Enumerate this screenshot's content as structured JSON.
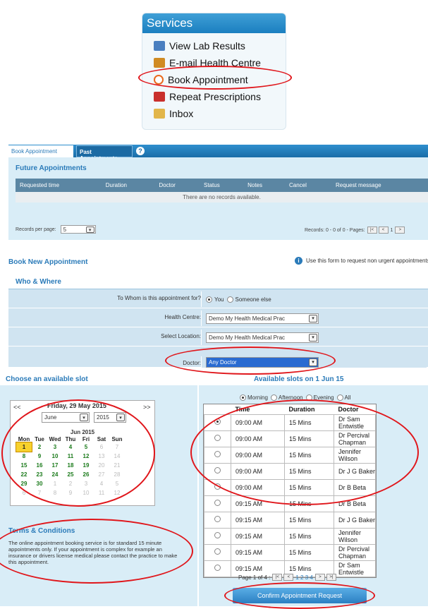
{
  "services": {
    "title": "Services",
    "items": [
      {
        "label": "View Lab Results",
        "icon": "lab-results-icon",
        "color": "#4a7fc0"
      },
      {
        "label": "E-mail Health Centre",
        "icon": "email-centre-icon",
        "color": "#d08b22"
      },
      {
        "label": "Book Appointment",
        "icon": "clock-icon",
        "color": "#e86a1e"
      },
      {
        "label": "Repeat Prescriptions",
        "icon": "pills-icon",
        "color": "#c9302c"
      },
      {
        "label": "Inbox",
        "icon": "envelope-icon",
        "color": "#e2b64a"
      }
    ]
  },
  "tabs": {
    "book": "Book Appointment",
    "past": "Past Appointments",
    "help": "?"
  },
  "future": {
    "title": "Future Appointments",
    "columns": [
      "Requested time",
      "Duration",
      "Doctor",
      "Status",
      "Notes",
      "Cancel",
      "Request message"
    ],
    "empty": "There are no records available.",
    "records_label": "Records per page:",
    "records_value": "5",
    "records_info": "Records: 0 - 0 of 0 - Pages:",
    "page": "1"
  },
  "book_new": {
    "title": "Book New Appointment",
    "info": "Use this form to request non urgent appointments"
  },
  "who_where": {
    "title": "Who & Where",
    "whom_label": "To Whom is this appointment for?",
    "whom_you": "You",
    "whom_else": "Someone else",
    "centre_label": "Health Centre:",
    "centre_value": "Demo My Health Medical Prac",
    "location_label": "Select Location:",
    "location_value": "Demo My Health Medical Prac",
    "doctor_label": "Doctor:",
    "doctor_value": "Any Doctor"
  },
  "slot": {
    "choose_title": "Choose an available slot",
    "available_title": "Available slots on 1 Jun 15",
    "filters": [
      "Morning",
      "Afternoon",
      "Evening",
      "All"
    ],
    "columns": [
      "Time",
      "Duration",
      "Doctor"
    ],
    "rows": [
      {
        "time": "09:00 AM",
        "duration": "15 Mins",
        "doctor": "Dr Sam Entwistle",
        "selected": true
      },
      {
        "time": "09:00 AM",
        "duration": "15 Mins",
        "doctor": "Dr Percival Chapman",
        "selected": false
      },
      {
        "time": "09:00 AM",
        "duration": "15 Mins",
        "doctor": "Jennifer Wilson",
        "selected": false
      },
      {
        "time": "09:00 AM",
        "duration": "15 Mins",
        "doctor": "Dr J G Baker",
        "selected": false
      },
      {
        "time": "09:00 AM",
        "duration": "15 Mins",
        "doctor": "Dr B Beta",
        "selected": false
      },
      {
        "time": "09:15 AM",
        "duration": "15 Mins",
        "doctor": "Dr B Beta",
        "selected": false
      },
      {
        "time": "09:15 AM",
        "duration": "15 Mins",
        "doctor": "Dr J G Baker",
        "selected": false
      },
      {
        "time": "09:15 AM",
        "duration": "15 Mins",
        "doctor": "Jennifer Wilson",
        "selected": false
      },
      {
        "time": "09:15 AM",
        "duration": "15 Mins",
        "doctor": "Dr Percival Chapman",
        "selected": false
      },
      {
        "time": "09:15 AM",
        "duration": "15 Mins",
        "doctor": "Dr Sam Entwistle",
        "selected": false
      }
    ],
    "page_info": "Page 1 of 4 :",
    "pages": "1 2 3 4",
    "confirm": "Confirm Appointment Request"
  },
  "calendar": {
    "current": "Friday, 29 May 2015",
    "prev": "<<",
    "next": ">>",
    "month": "June",
    "year": "2015",
    "month_title": "Jun 2015",
    "weekdays": [
      "Mon",
      "Tue",
      "Wed",
      "Thu",
      "Fri",
      "Sat",
      "Sun"
    ],
    "weeks": [
      [
        "1",
        "2",
        "3",
        "4",
        "5",
        "6",
        "7"
      ],
      [
        "8",
        "9",
        "10",
        "11",
        "12",
        "13",
        "14"
      ],
      [
        "15",
        "16",
        "17",
        "18",
        "19",
        "20",
        "21"
      ],
      [
        "22",
        "23",
        "24",
        "25",
        "26",
        "27",
        "28"
      ],
      [
        "29",
        "30",
        "1",
        "2",
        "3",
        "4",
        "5"
      ],
      [
        "6",
        "7",
        "8",
        "9",
        "10",
        "11",
        "12"
      ]
    ]
  },
  "terms": {
    "title": "Terms & Conditions",
    "text": "The online appointment booking service is for standard 15 minute appointments only. If your appointment is complex for example an insurance or drivers license medical please contact the practice to make this appointment."
  }
}
